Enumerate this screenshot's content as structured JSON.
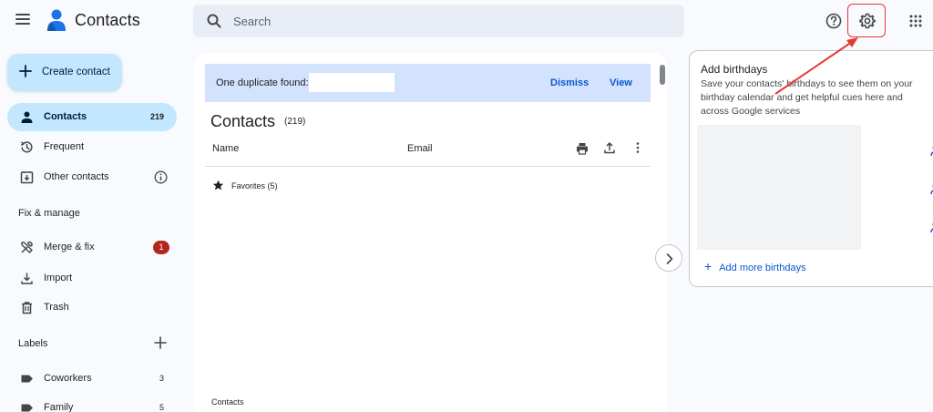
{
  "app": {
    "title": "Contacts"
  },
  "search": {
    "placeholder": "Search"
  },
  "header_icons": [
    "menu-icon",
    "help-icon",
    "settings-icon",
    "apps-grid-icon"
  ],
  "sidebar": {
    "create_label": "Create contact",
    "items": [
      {
        "label": "Contacts",
        "count": "219",
        "active": true,
        "icon": "person-icon"
      },
      {
        "label": "Frequent",
        "icon": "history-icon"
      },
      {
        "label": "Other contacts",
        "icon": "download-box-icon",
        "info": true
      }
    ],
    "fix_manage_heading": "Fix & manage",
    "fix_items": [
      {
        "label": "Merge & fix",
        "badge": "1",
        "icon": "merge-tools-icon"
      },
      {
        "label": "Import",
        "icon": "import-icon"
      },
      {
        "label": "Trash",
        "icon": "trash-icon"
      }
    ],
    "labels_heading": "Labels",
    "labels": [
      {
        "label": "Coworkers",
        "count": "3"
      },
      {
        "label": "Family",
        "count": "5"
      }
    ]
  },
  "main": {
    "duplicate_text": "One duplicate found:",
    "dismiss_label": "Dismiss",
    "view_label": "View",
    "title": "Contacts",
    "count": "(219)",
    "col_name": "Name",
    "col_email": "Email",
    "favorites_label": "Favorites (5)",
    "bottom_label": "Contacts"
  },
  "side_panel": {
    "title": "Add birthdays",
    "description": "Save your contacts' birthdays to see them on your birthday calendar and get helpful cues here and across Google services",
    "add_more_label": "Add more birthdays"
  },
  "colors": {
    "accent": "#0b57d0",
    "active_bg": "#c2e7ff",
    "banner_bg": "#d3e3fd",
    "badge": "#b3261e",
    "annotation": "#e53935"
  }
}
